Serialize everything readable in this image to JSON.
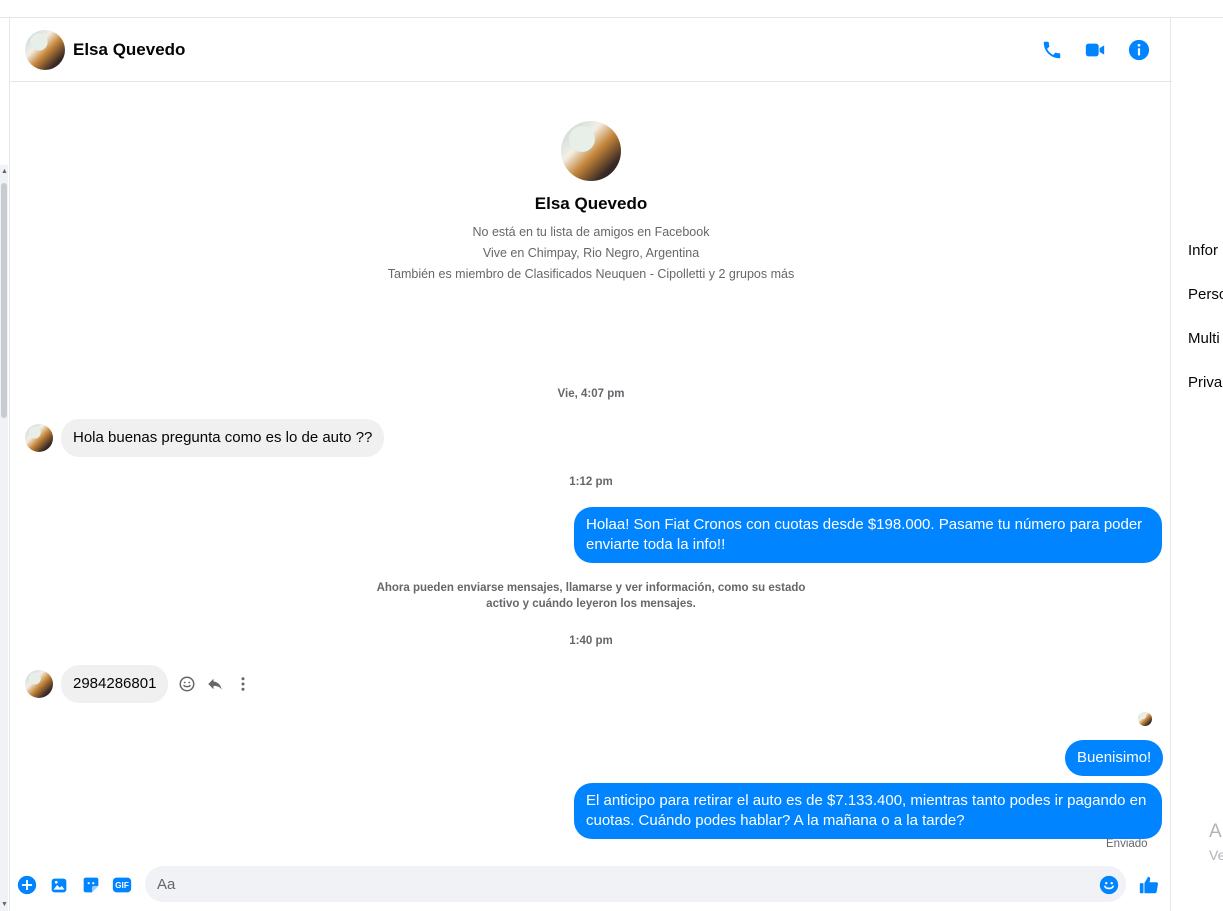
{
  "header": {
    "contact_name": "Elsa Quevedo"
  },
  "profile": {
    "name": "Elsa Quevedo",
    "meta": [
      "No está en tu lista de amigos en Facebook",
      "Vive en Chimpay, Rio Negro, Argentina",
      "También es miembro de Clasificados Neuquen - Cipolletti y 2 grupos más"
    ]
  },
  "timestamps": {
    "t1": "Vie, 4:07 pm",
    "t2": "1:12 pm",
    "t3": "1:40 pm"
  },
  "messages": {
    "in1": "Hola buenas pregunta como es lo de auto ??",
    "out1": "Holaa! Son Fiat Cronos con cuotas desde $198.000. Pasame tu número para poder enviarte toda la info!!",
    "in2": "2984286801",
    "out2": "Buenisimo!",
    "out3": "El anticipo para retirar el auto es de $7.133.400, mientras tanto podes ir pagando en cuotas. Cuándo podes hablar? A la mañana o a la tarde?"
  },
  "system_message": "Ahora pueden enviarse mensajes, llamarse y ver información, como su estado activo y cuándo leyeron los mensajes.",
  "status": {
    "sent": "Enviado"
  },
  "composer": {
    "placeholder": "Aa"
  },
  "right_panel": {
    "items": [
      "Infor",
      "Perso",
      "Multi",
      "Priva"
    ],
    "trailing": [
      "A",
      "Ve"
    ]
  },
  "colors": {
    "accent": "#0084ff",
    "incoming_bubble": "#f0f0f0",
    "secondary_text": "#65676b"
  }
}
